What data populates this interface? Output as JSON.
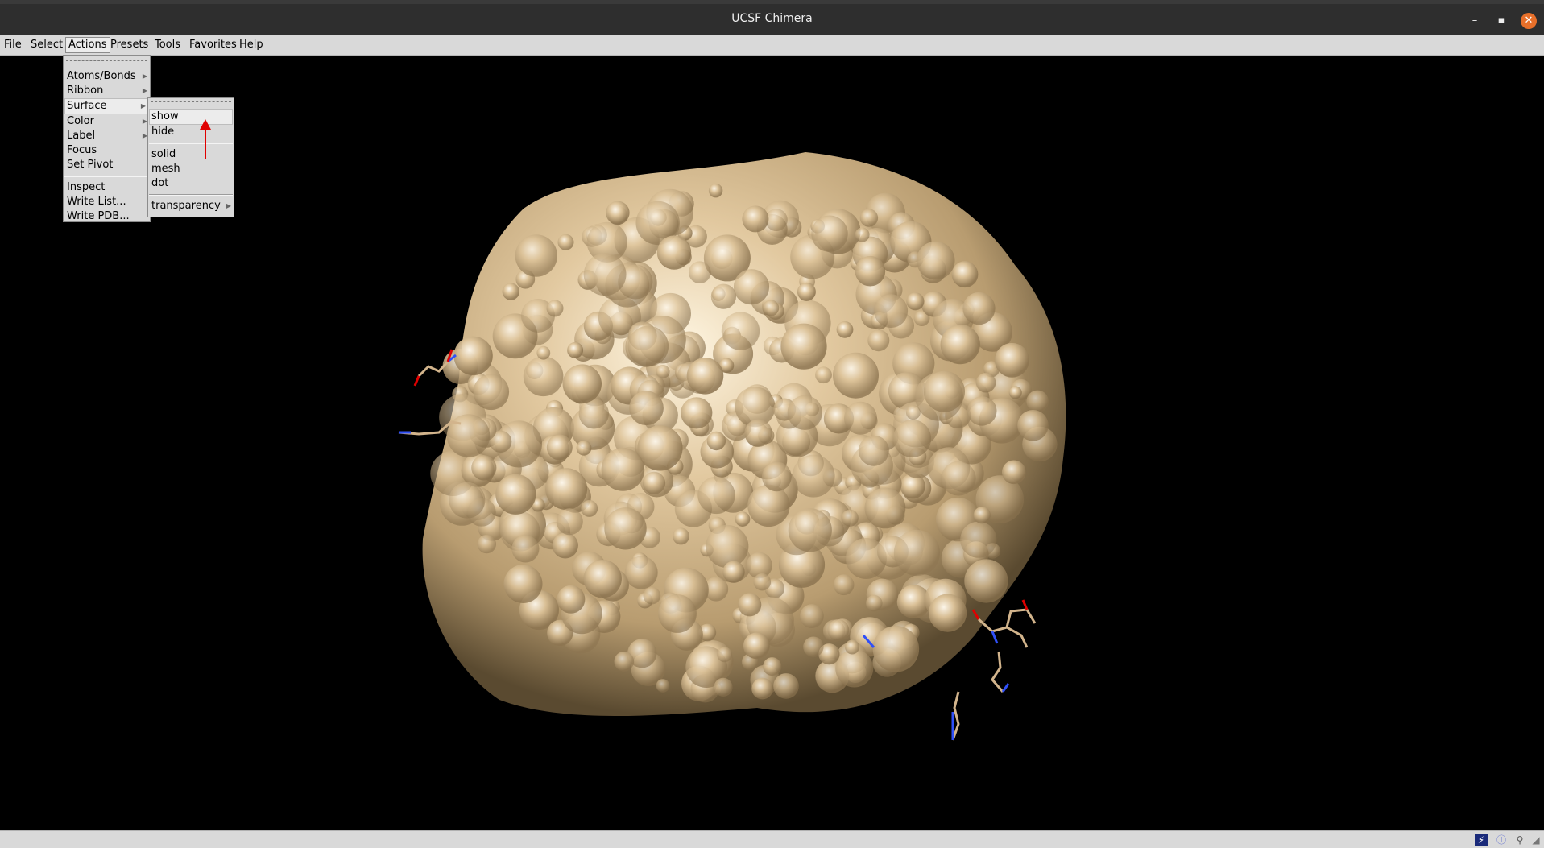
{
  "window": {
    "title": "UCSF Chimera",
    "minimize_glyph": "–",
    "maximize_glyph": "▪",
    "close_glyph": "✕"
  },
  "menubar": {
    "items": [
      "File",
      "Select",
      "Actions",
      "Presets",
      "Tools",
      "Favorites",
      "Help"
    ]
  },
  "actions_menu": {
    "items": [
      "Atoms/Bonds",
      "Ribbon",
      "Surface",
      "Color",
      "Label",
      "Focus",
      "Set Pivot",
      "Inspect",
      "Write List...",
      "Write PDB..."
    ],
    "highlighted": "Surface"
  },
  "surface_menu": {
    "items": [
      "show",
      "hide",
      "solid",
      "mesh",
      "dot",
      "transparency"
    ],
    "highlighted": "show"
  },
  "viewer": {
    "background": "#000000",
    "surface_color": "#d2b48c",
    "content": "molecular surface"
  },
  "statusbar": {
    "icons": [
      "lightning-icon",
      "info-icon",
      "magnifier-icon",
      "resize-grip-icon"
    ]
  },
  "colors": {
    "titlebar": "#2e2e2e",
    "menu_bg": "#d9d9d9",
    "close_button": "#e8702a",
    "annotation_arrow": "#e00000"
  }
}
